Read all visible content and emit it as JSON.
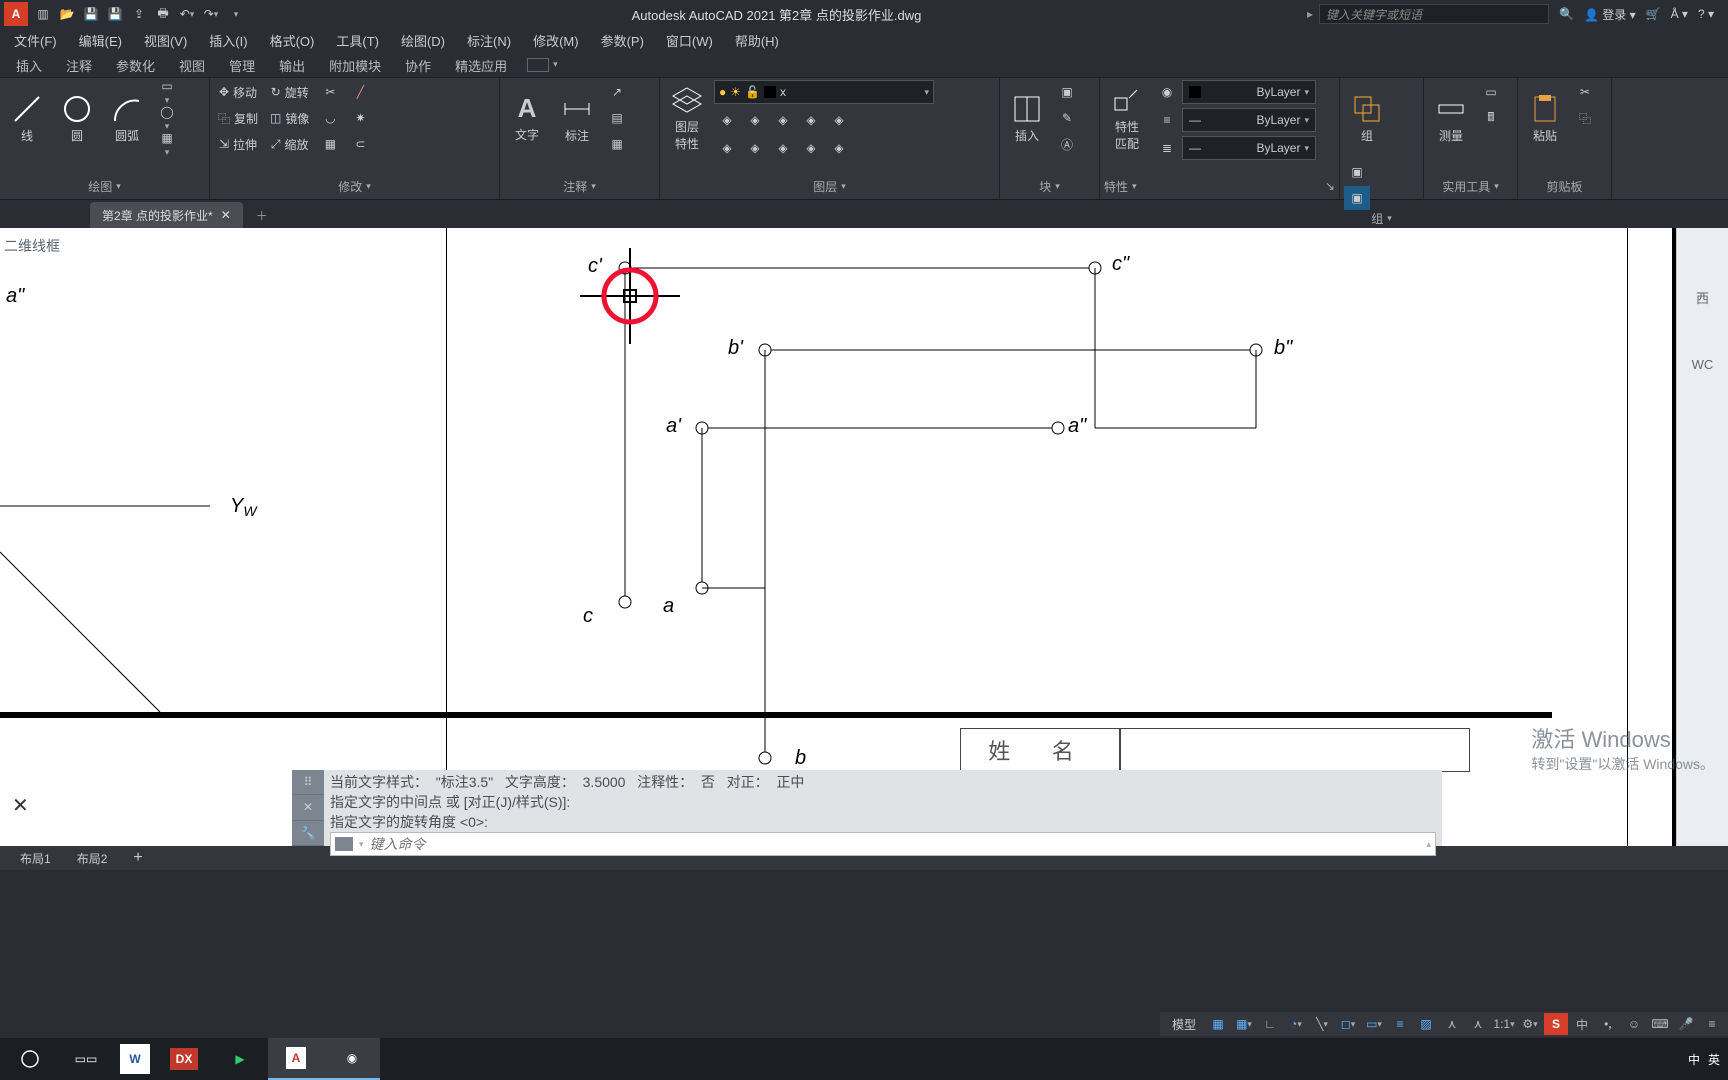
{
  "title_bar": {
    "app_title": "Autodesk AutoCAD 2021   第2章 点的投影作业.dwg",
    "search_placeholder": "键入关键字或短语",
    "login_label": "登录"
  },
  "menus": [
    "文件(F)",
    "编辑(E)",
    "视图(V)",
    "插入(I)",
    "格式(O)",
    "工具(T)",
    "绘图(D)",
    "标注(N)",
    "修改(M)",
    "参数(P)",
    "窗口(W)",
    "帮助(H)"
  ],
  "ctx_tabs": [
    "插入",
    "注释",
    "参数化",
    "视图",
    "管理",
    "输出",
    "附加模块",
    "协作",
    "精选应用"
  ],
  "ribbon": {
    "draw": {
      "title": "绘图",
      "line": "线",
      "polyline": "圆",
      "arc": "圆弧"
    },
    "modify": {
      "title": "修改",
      "move": "移动",
      "rotate": "旋转",
      "copy": "复制",
      "mirror": "镜像",
      "stretch": "拉伸",
      "scale": "缩放"
    },
    "annotate": {
      "title": "注释",
      "text": "文字",
      "dim": "标注"
    },
    "layers": {
      "title": "图层",
      "props": "图层\n特性",
      "close_x": "x"
    },
    "block": {
      "title": "块",
      "insert": "插入"
    },
    "props": {
      "title": "特性",
      "match": "特性\n匹配",
      "bylayer": "ByLayer"
    },
    "group": {
      "title": "组",
      "group": "组"
    },
    "utils": {
      "title": "实用工具",
      "measure": "测量"
    },
    "clip": {
      "title": "剪贴板",
      "paste": "粘贴"
    }
  },
  "doc_tab": {
    "name": "第2章 点的投影作业*"
  },
  "viewport_label": "二维线框",
  "drawing_labels": {
    "a2": "a\"",
    "yw": "Yw",
    "cp": "c'",
    "c2": "c\"",
    "bp": "b'",
    "b2": "b\"",
    "ap": "a'",
    "a2b": "a\"",
    "a": "a",
    "c": "c",
    "b": "b"
  },
  "right_pal": {
    "p1": "西",
    "p2": "WC"
  },
  "name_cell": "姓 名",
  "cmd": {
    "l1_a": "当前文字样式：",
    "l1_b": "\"标注3.5\"",
    "l1_c": "文字高度：",
    "l1_d": "3.5000",
    "l1_e": "注释性：",
    "l1_f": "否",
    "l1_g": "对正：",
    "l1_h": "正中",
    "l2": "指定文字的中间点 或 [对正(J)/样式(S)]:",
    "l3": "指定文字的旋转角度 <0>:",
    "input_ph": "键入命令"
  },
  "layout_tabs": [
    "布局1",
    "布局2"
  ],
  "status": {
    "model": "模型",
    "scale": "1:1",
    "ime_s": "S",
    "ime_zh": "中",
    "ime_en": "英"
  },
  "watermark": {
    "l1": "激活 Windows",
    "l2": "转到\"设置\"以激活 Windows。"
  },
  "taskbar": {
    "dx": "DX",
    "tray_zh": "中",
    "tray_en": "英"
  }
}
